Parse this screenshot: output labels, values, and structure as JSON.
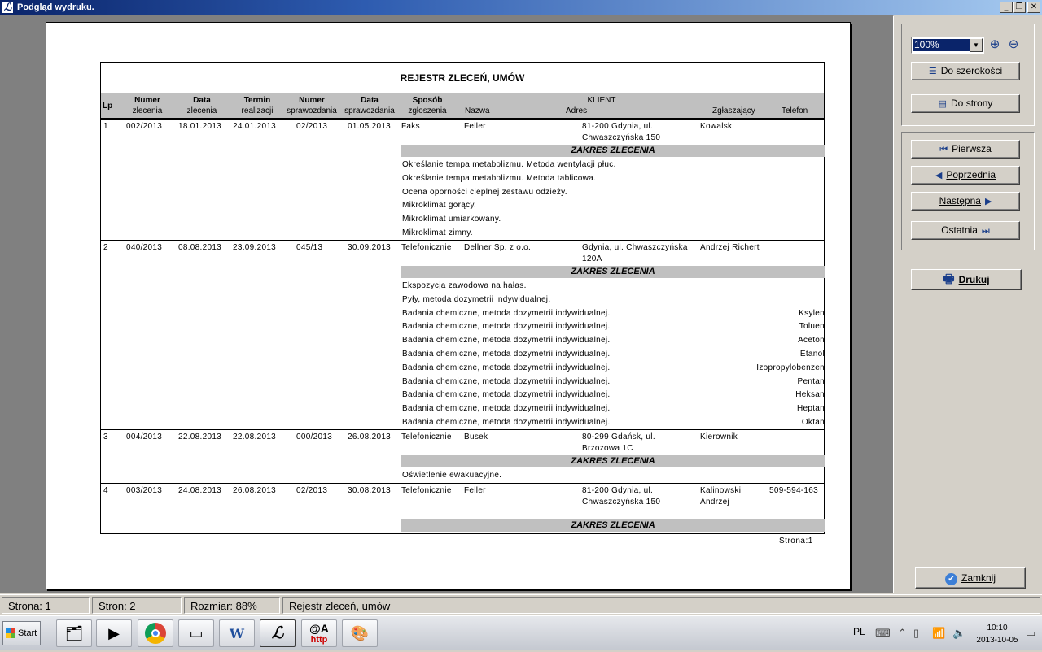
{
  "window": {
    "title": "Podgląd wydruku."
  },
  "report": {
    "title": "REJESTR ZLECEŃ, UMÓW",
    "headers": {
      "lp": "Lp",
      "numer_zlecenia": [
        "Numer",
        "zlecenia"
      ],
      "data_zlecenia": [
        "Data",
        "zlecenia"
      ],
      "termin": [
        "Termin",
        "realizacji"
      ],
      "numer_spraw": [
        "Numer",
        "sprawozdania"
      ],
      "data_spraw": [
        "Data",
        "sprawozdania"
      ],
      "sposob": [
        "Sposób",
        "zgłoszenia"
      ],
      "klient": "KLIENT",
      "nazwa": "Nazwa",
      "adres": "Adres",
      "zglaszajacy": "Zgłaszający",
      "telefon": "Telefon"
    },
    "zakres_label": "ZAKRES ZLECENIA",
    "records": [
      {
        "lp": "1",
        "nr": "002/2013",
        "data": "18.01.2013",
        "termin": "24.01.2013",
        "nr_spr": "02/2013",
        "data_spr": "01.05.2013",
        "sposob": "Faks",
        "nazwa": "Feller",
        "adres": [
          "81-200 Gdynia, ul.",
          "Chwaszczyńska 150"
        ],
        "zglaszajacy": [
          "Kowalski"
        ],
        "telefon": "",
        "items": [
          {
            "t": "Określanie tempa metabolizmu. Metoda wentylacji płuc.",
            "s": ""
          },
          {
            "t": "Określanie tempa metabolizmu. Metoda tablicowa.",
            "s": ""
          },
          {
            "t": "Ocena oporności cieplnej zestawu odzieży.",
            "s": ""
          },
          {
            "t": "Mikroklimat gorący.",
            "s": ""
          },
          {
            "t": "Mikroklimat umiarkowany.",
            "s": ""
          },
          {
            "t": "Mikroklimat zimny.",
            "s": ""
          }
        ]
      },
      {
        "lp": "2",
        "nr": "040/2013",
        "data": "08.08.2013",
        "termin": "23.09.2013",
        "nr_spr": "045/13",
        "data_spr": "30.09.2013",
        "sposob": "Telefonicznie",
        "nazwa": "Dellner Sp. z o.o.",
        "adres": [
          "Gdynia, ul. Chwaszczyńska",
          "120A"
        ],
        "zglaszajacy": [
          "Andrzej Richert"
        ],
        "telefon": "",
        "items": [
          {
            "t": "Ekspozycja zawodowa na hałas.",
            "s": ""
          },
          {
            "t": "Pyły, metoda dozymetrii indywidualnej.",
            "s": ""
          },
          {
            "t": "Badania chemiczne, metoda dozymetrii indywidualnej.",
            "s": "Ksylen"
          },
          {
            "t": "Badania chemiczne, metoda dozymetrii indywidualnej.",
            "s": "Toluen"
          },
          {
            "t": "Badania chemiczne, metoda dozymetrii indywidualnej.",
            "s": "Aceton"
          },
          {
            "t": "Badania chemiczne, metoda dozymetrii indywidualnej.",
            "s": "Etanol"
          },
          {
            "t": "Badania chemiczne, metoda dozymetrii indywidualnej.",
            "s": "Izopropylobenzen"
          },
          {
            "t": "Badania chemiczne, metoda dozymetrii indywidualnej.",
            "s": "Pentan"
          },
          {
            "t": "Badania chemiczne, metoda dozymetrii indywidualnej.",
            "s": "Heksan"
          },
          {
            "t": "Badania chemiczne, metoda dozymetrii indywidualnej.",
            "s": "Heptan"
          },
          {
            "t": "Badania chemiczne, metoda dozymetrii indywidualnej.",
            "s": "Oktan"
          }
        ]
      },
      {
        "lp": "3",
        "nr": "004/2013",
        "data": "22.08.2013",
        "termin": "22.08.2013",
        "nr_spr": "000/2013",
        "data_spr": "26.08.2013",
        "sposob": "Telefonicznie",
        "nazwa": "Busek",
        "adres": [
          "80-299 Gdańsk, ul.",
          "Brzozowa 1C"
        ],
        "zglaszajacy": [
          "Kierownik"
        ],
        "telefon": "",
        "items": [
          {
            "t": "Oświetlenie ewakuacyjne.",
            "s": ""
          }
        ]
      },
      {
        "lp": "4",
        "nr": "003/2013",
        "data": "24.08.2013",
        "termin": "26.08.2013",
        "nr_spr": "02/2013",
        "data_spr": "30.08.2013",
        "sposob": "Telefonicznie",
        "nazwa": "Feller",
        "adres": [
          "81-200 Gdynia, ul.",
          "Chwaszczyńska 150"
        ],
        "zglaszajacy": [
          "Kalinowski",
          "Andrzej"
        ],
        "telefon": "509-594-163",
        "items": []
      }
    ],
    "page_footer": "Strona:1"
  },
  "panel": {
    "zoom_value": "100%",
    "fit_width": "Do szerokości",
    "fit_page": "Do strony",
    "first": "Pierwsza",
    "prev": "Poprzednia",
    "next": "Następna",
    "last": "Ostatnia",
    "print": "Drukuj",
    "close": "Zamknij"
  },
  "status": {
    "page": "Strona: 1",
    "pages": "Stron: 2",
    "size": "Rozmiar: 88%",
    "name": "Rejestr zleceń, umów"
  },
  "taskbar": {
    "start": "Start",
    "lang": "PL",
    "time": "10:10",
    "date": "2013-10-05",
    "at_label": "@A",
    "http_label": "http"
  }
}
